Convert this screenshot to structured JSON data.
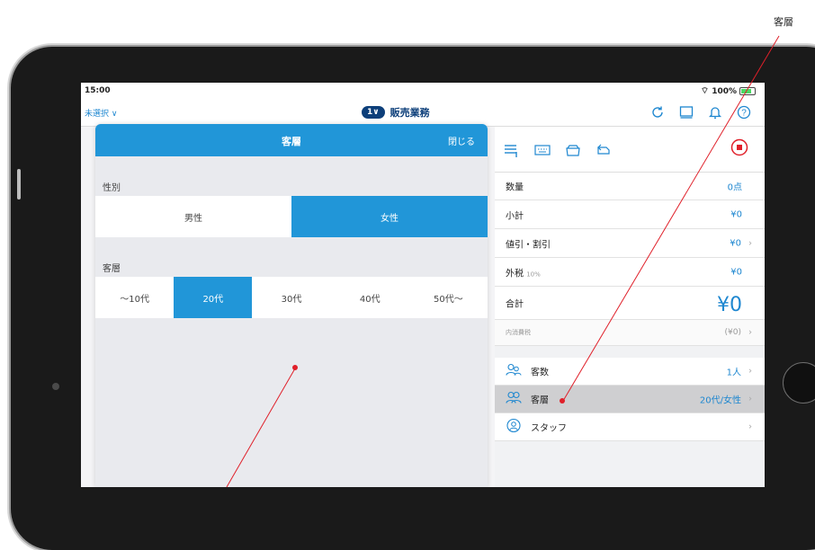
{
  "callout": {
    "label": "客層"
  },
  "status": {
    "time": "15:00",
    "battery": "100%"
  },
  "nav": {
    "left": "未選択 ∨",
    "badge": "1∨",
    "title": "販売業務"
  },
  "panel": {
    "title": "客層",
    "close": "閉じる",
    "gender_label": "性別",
    "gender_options": [
      "男性",
      "女性"
    ],
    "gender_selected": 1,
    "age_label": "客層",
    "age_options": [
      "～10代",
      "20代",
      "30代",
      "40代",
      "50代～"
    ],
    "age_selected": 1
  },
  "summary": {
    "quantity_label": "数量",
    "quantity_value": "0点",
    "subtotal_label": "小計",
    "subtotal_value": "¥0",
    "discount_label": "値引・割引",
    "discount_value": "¥0",
    "tax_label": "外税",
    "tax_rate": "10%",
    "tax_value": "¥0",
    "total_label": "合計",
    "total_value": "¥0",
    "incl_tax_label": "内消費税",
    "incl_tax_value": "(¥0)"
  },
  "customer": {
    "count_label": "客数",
    "count_value": "1人",
    "layer_label": "客層",
    "layer_value": "20代/女性",
    "staff_label": "スタッフ"
  },
  "colors": {
    "accent": "#2196d8",
    "navy": "#0d3f7a",
    "red": "#e0202a"
  },
  "icons": [
    "refresh-icon",
    "receipt-printer-icon",
    "bell-icon",
    "help-icon",
    "list-icon",
    "keyboard-icon",
    "cash-drawer-icon",
    "return-icon",
    "stop-icon",
    "customer-count-icon",
    "customer-layer-icon",
    "staff-icon"
  ]
}
